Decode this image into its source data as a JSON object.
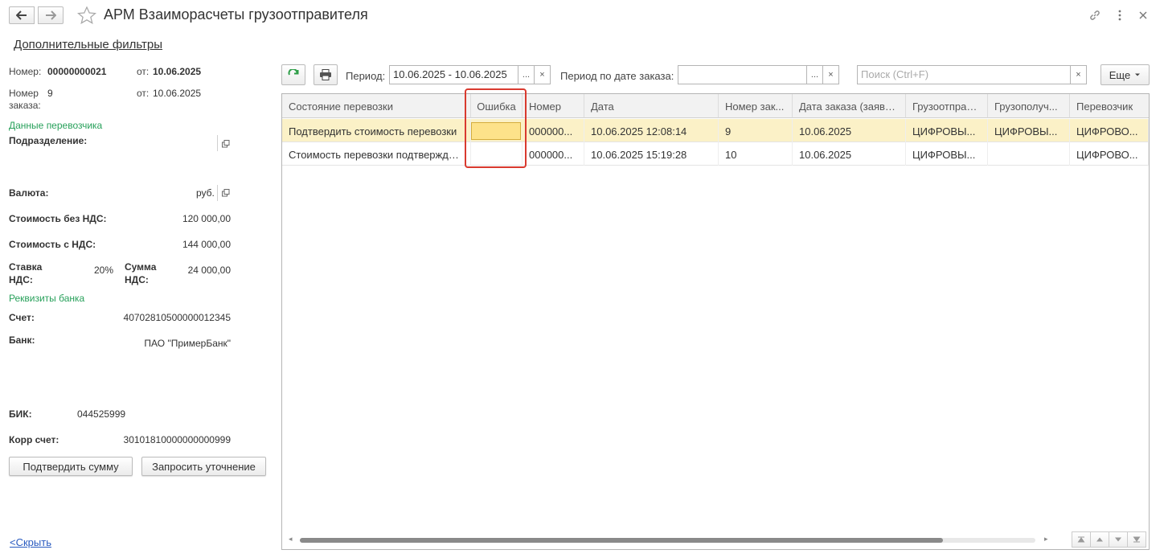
{
  "window": {
    "title": "АРМ Взаиморасчеты грузоотправителя",
    "back_icon": "arrow-left-icon",
    "forward_icon": "arrow-right-icon",
    "favorite_icon": "star-icon",
    "link_icon": "link-icon",
    "menu_icon": "more-vertical-icon",
    "close_icon": "close-icon"
  },
  "extra_filters_label": "Дополнительные фильтры",
  "details": {
    "number_label": "Номер:",
    "number_value": "00000000021",
    "date_label": "от:",
    "date_value": "10.06.2025",
    "order_number_label_line1": "Номер",
    "order_number_label_line2": "заказа:",
    "order_number_value": "9",
    "order_date_label": "от:",
    "order_date_value": "10.06.2025",
    "carrier_section": "Данные перевозчика",
    "subdivision_label": "Подразделение:",
    "subdivision_value": "",
    "currency_label": "Валюта:",
    "currency_value": "руб.",
    "cost_no_vat_label": "Стоимость без НДС:",
    "cost_no_vat_value": "120 000,00",
    "cost_with_vat_label": "Стоимость с НДС:",
    "cost_with_vat_value": "144 000,00",
    "vat_rate_label_line1": "Ставка",
    "vat_rate_label_line2": "НДС:",
    "vat_rate_value": "20%",
    "vat_sum_label_line1": "Сумма",
    "vat_sum_label_line2": "НДС:",
    "vat_sum_value": "24 000,00",
    "bank_section": "Реквизиты банка",
    "account_label": "Счет:",
    "account_value": "40702810500000012345",
    "bank_label": "Банк:",
    "bank_value": "ПАО \"ПримерБанк\"",
    "bik_label": "БИК:",
    "bik_value": "044525999",
    "corr_label": "Корр счет:",
    "corr_value": "30101810000000000999"
  },
  "buttons": {
    "confirm_sum": "Подтвердить сумму",
    "request_clarification": "Запросить уточнение",
    "hide": "<Скрыть"
  },
  "toolbar": {
    "refresh_icon": "refresh-icon",
    "print_icon": "printer-icon",
    "period_label": "Период:",
    "period_value": "10.06.2025 - 10.06.2025",
    "order_period_label": "Период по дате заказа:",
    "order_period_value": "",
    "search_placeholder": "Поиск (Ctrl+F)",
    "dots": "...",
    "clear": "×",
    "more_label": "Еще"
  },
  "table": {
    "columns": [
      "Состояние перевозки",
      "Ошибка",
      "Номер",
      "Дата",
      "Номер зак...",
      "Дата заказа (заявки)",
      "Грузоотправ...",
      "Грузополуч...",
      "Перевозчик"
    ],
    "rows": [
      {
        "state": "Подтвердить стоимость перевозки",
        "error": "",
        "number": "000000...",
        "date": "10.06.2025 12:08:14",
        "order_number": "9",
        "order_date": "10.06.2025",
        "shipper": "ЦИФРОВЫ...",
        "consignee": "ЦИФРОВЫ...",
        "carrier": "ЦИФРОВО..."
      },
      {
        "state": "Стоимость перевозки подтверждена",
        "error": "",
        "number": "000000...",
        "date": "10.06.2025 15:19:28",
        "order_number": "10",
        "order_date": "10.06.2025",
        "shipper": "ЦИФРОВЫ...",
        "consignee": "",
        "carrier": "ЦИФРОВО..."
      }
    ]
  },
  "colors": {
    "accent_green": "#27a05a",
    "highlight_red": "#d93a2f",
    "selected_row": "#fbf1c7",
    "error_cell": "#fde28a"
  }
}
